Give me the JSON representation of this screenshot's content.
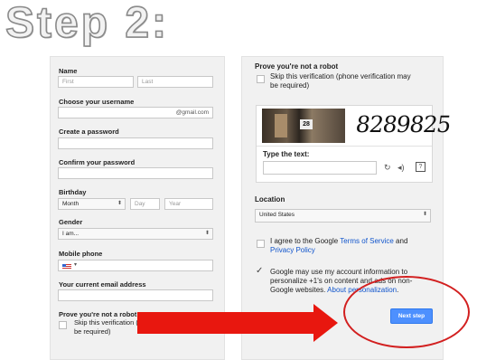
{
  "step_title": "Step 2:",
  "form": {
    "name_label": "Name",
    "first_placeholder": "First",
    "last_placeholder": "Last",
    "username_label": "Choose your username",
    "username_suffix": "@gmail.com",
    "password_label": "Create a password",
    "confirm_label": "Confirm your password",
    "birthday_label": "Birthday",
    "month_value": "Month",
    "day_placeholder": "Day",
    "year_placeholder": "Year",
    "gender_label": "Gender",
    "gender_value": "I am...",
    "phone_label": "Mobile phone",
    "email_label": "Your current email address",
    "robot_label": "Prove you're not a robot",
    "skip_verify_line1": "Skip this verification (p",
    "skip_verify_line2": "be required)"
  },
  "right": {
    "robot_heading": "Prove you're not a robot",
    "skip_line1": "Skip this verification (phone verification may",
    "skip_line2": "be required)",
    "captcha_house_number": "28",
    "captcha_text": "8289825",
    "type_text_label": "Type the text:",
    "refresh_icon": "refresh-icon",
    "audio_icon": "audio-icon",
    "help_icon": "help-icon",
    "location_label": "Location",
    "location_value": "United States",
    "agree_pre": "I agree to the Google ",
    "tos_link": "Terms of Service",
    "agree_and": " and",
    "privacy_link": "Privacy Policy",
    "personalize_line1": "Google may use my account information to",
    "personalize_line2": "personalize +1's on content and ads on non-",
    "personalize_line3_pre": "Google websites. ",
    "personalize_link": "About personalization",
    "personalize_line3_post": ".",
    "next_button": "Next step"
  },
  "colors": {
    "arrow": "#e8170f",
    "oval": "#d21f1f",
    "button": "#4d90fe",
    "link": "#1155cc"
  }
}
